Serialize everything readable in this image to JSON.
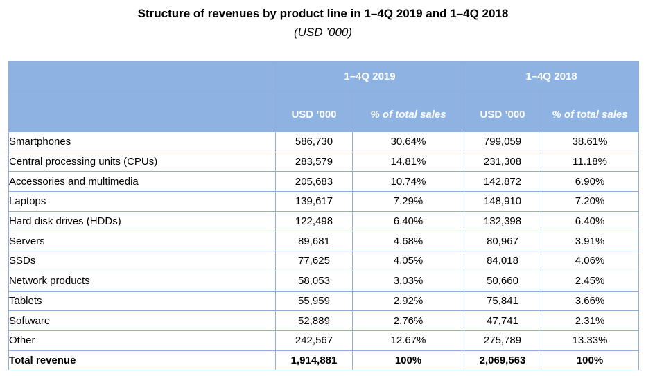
{
  "title": "Structure of revenues by product line in 1–4Q 2019 and 1–4Q 2018",
  "subtitle": "(USD ’000)",
  "periods": [
    "1–4Q 2019",
    "1–4Q 2018"
  ],
  "columns": [
    "USD ’000",
    "% of total sales",
    "USD ’000",
    "% of total sales"
  ],
  "rows": [
    {
      "label": "Smartphones",
      "v2019": "586,730",
      "p2019": "30.64%",
      "v2018": "799,059",
      "p2018": "38.61%"
    },
    {
      "label": "Central processing units (CPUs)",
      "v2019": "283,579",
      "p2019": "14.81%",
      "v2018": "231,308",
      "p2018": "11.18%"
    },
    {
      "label": "Accessories and multimedia",
      "v2019": "205,683",
      "p2019": "10.74%",
      "v2018": "142,872",
      "p2018": "6.90%"
    },
    {
      "label": "Laptops",
      "v2019": "139,617",
      "p2019": "7.29%",
      "v2018": "148,910",
      "p2018": "7.20%"
    },
    {
      "label": "Hard disk drives (HDDs)",
      "v2019": "122,498",
      "p2019": "6.40%",
      "v2018": "132,398",
      "p2018": "6.40%"
    },
    {
      "label": "Servers",
      "v2019": "89,681",
      "p2019": "4.68%",
      "v2018": "80,967",
      "p2018": "3.91%"
    },
    {
      "label": "SSDs",
      "v2019": "77,625",
      "p2019": "4.05%",
      "v2018": "84,018",
      "p2018": "4.06%"
    },
    {
      "label": "Network products",
      "v2019": "58,053",
      "p2019": "3.03%",
      "v2018": "50,660",
      "p2018": "2.45%"
    },
    {
      "label": "Tablets",
      "v2019": "55,959",
      "p2019": "2.92%",
      "v2018": "75,841",
      "p2018": "3.66%"
    },
    {
      "label": "Software",
      "v2019": "52,889",
      "p2019": "2.76%",
      "v2018": "47,741",
      "p2018": "2.31%"
    },
    {
      "label": "Other",
      "v2019": "242,567",
      "p2019": "12.67%",
      "v2018": "275,789",
      "p2018": "13.33%"
    }
  ],
  "total": {
    "label": "Total revenue",
    "v2019": "1,914,881",
    "p2019": "100%",
    "v2018": "2,069,563",
    "p2018": "100%"
  },
  "colors": {
    "header_bg": "#8eb3e2",
    "border": "#8eaedb",
    "header_text": "#ffffff"
  }
}
